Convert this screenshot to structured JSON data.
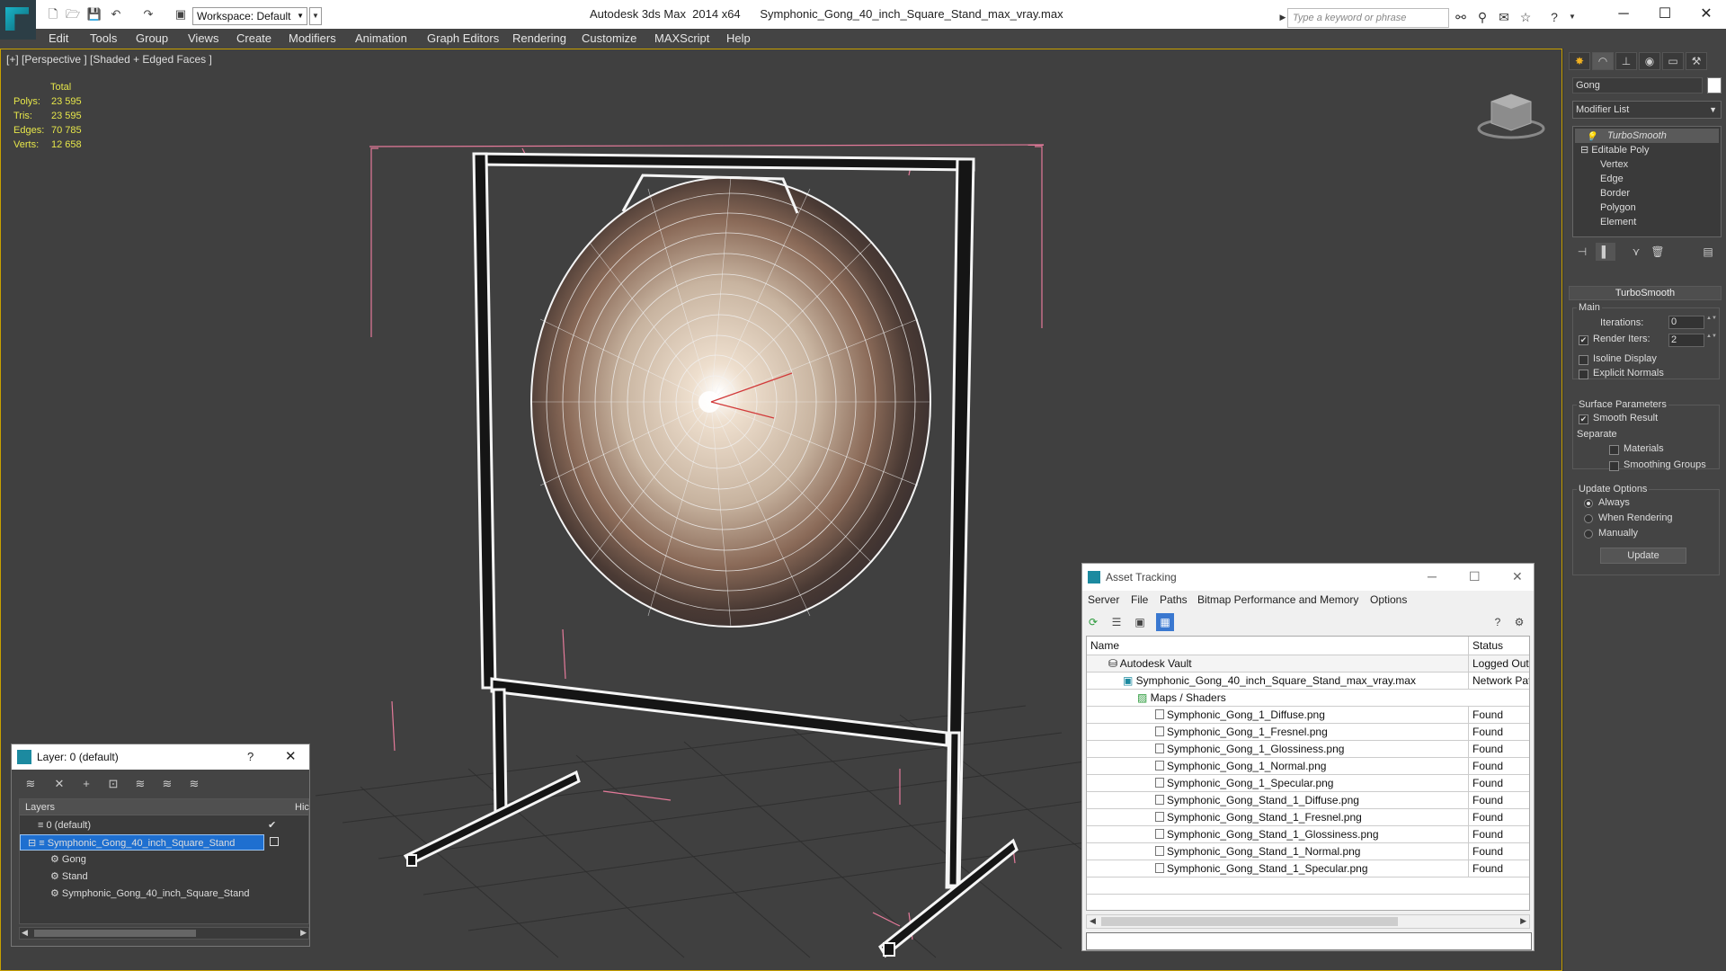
{
  "titlebar": {
    "workspace_label": "Workspace: Default",
    "app_title": "Autodesk 3ds Max  2014 x64      Symphonic_Gong_40_inch_Square_Stand_max_vray.max",
    "search_placeholder": "Type a keyword or phrase",
    "minimize": "─",
    "maximize": "☐",
    "close": "✕"
  },
  "menubar": {
    "items": [
      "Edit",
      "Tools",
      "Group",
      "Views",
      "Create",
      "Modifiers",
      "Animation",
      "Graph Editors",
      "Rendering",
      "Customize",
      "MAXScript",
      "Help"
    ]
  },
  "viewport": {
    "label": "[+] [Perspective ] [Shaded + Edged Faces ]",
    "stats": {
      "header": "Total",
      "polys_label": "Polys:",
      "polys": "23 595",
      "tris_label": "Tris:",
      "tris": "23 595",
      "edges_label": "Edges:",
      "edges": "70 785",
      "verts_label": "Verts:",
      "verts": "12 658"
    },
    "accent_color": "#c8a000"
  },
  "command_panel": {
    "object_name": "Gong",
    "modifier_list_label": "Modifier List",
    "stack": {
      "top": "TurboSmooth",
      "base": "Editable Poly",
      "subobjects": [
        "Vertex",
        "Edge",
        "Border",
        "Polygon",
        "Element"
      ]
    },
    "turbosmooth": {
      "header": "TurboSmooth",
      "main_group": "Main",
      "iterations_label": "Iterations:",
      "iterations_value": "0",
      "render_iters_label": "Render Iters:",
      "render_iters_value": "2",
      "render_iters_checked": true,
      "isoline_label": "Isoline Display",
      "explicit_normals_label": "Explicit Normals",
      "surface_group": "Surface Parameters",
      "smooth_result_label": "Smooth Result",
      "separate_label": "Separate",
      "materials_label": "Materials",
      "smoothing_groups_label": "Smoothing Groups",
      "update_group": "Update Options",
      "always_label": "Always",
      "when_rendering_label": "When Rendering",
      "manually_label": "Manually",
      "update_button": "Update"
    }
  },
  "layer_panel": {
    "title": "Layer: 0 (default)",
    "help": "?",
    "close": "✕",
    "col_layers": "Layers",
    "col_hide": "Hic",
    "rows": [
      {
        "name": "0 (default)"
      },
      {
        "name": "Symphonic_Gong_40_inch_Square_Stand"
      },
      {
        "name": "Gong"
      },
      {
        "name": "Stand"
      },
      {
        "name": "Symphonic_Gong_40_inch_Square_Stand"
      }
    ]
  },
  "asset_tracking": {
    "title": "Asset Tracking",
    "menu": [
      "Server",
      "File",
      "Paths",
      "Bitmap Performance and Memory",
      "Options"
    ],
    "col_name": "Name",
    "col_status": "Status",
    "rows": [
      {
        "name": "Autodesk Vault",
        "status": "Logged Out ..."
      },
      {
        "name": "Symphonic_Gong_40_inch_Square_Stand_max_vray.max",
        "status": "Network Path"
      },
      {
        "name": "Maps / Shaders",
        "status": ""
      },
      {
        "name": "Symphonic_Gong_1_Diffuse.png",
        "status": "Found"
      },
      {
        "name": "Symphonic_Gong_1_Fresnel.png",
        "status": "Found"
      },
      {
        "name": "Symphonic_Gong_1_Glossiness.png",
        "status": "Found"
      },
      {
        "name": "Symphonic_Gong_1_Normal.png",
        "status": "Found"
      },
      {
        "name": "Symphonic_Gong_1_Specular.png",
        "status": "Found"
      },
      {
        "name": "Symphonic_Gong_Stand_1_Diffuse.png",
        "status": "Found"
      },
      {
        "name": "Symphonic_Gong_Stand_1_Fresnel.png",
        "status": "Found"
      },
      {
        "name": "Symphonic_Gong_Stand_1_Glossiness.png",
        "status": "Found"
      },
      {
        "name": "Symphonic_Gong_Stand_1_Normal.png",
        "status": "Found"
      },
      {
        "name": "Symphonic_Gong_Stand_1_Specular.png",
        "status": "Found"
      }
    ]
  }
}
